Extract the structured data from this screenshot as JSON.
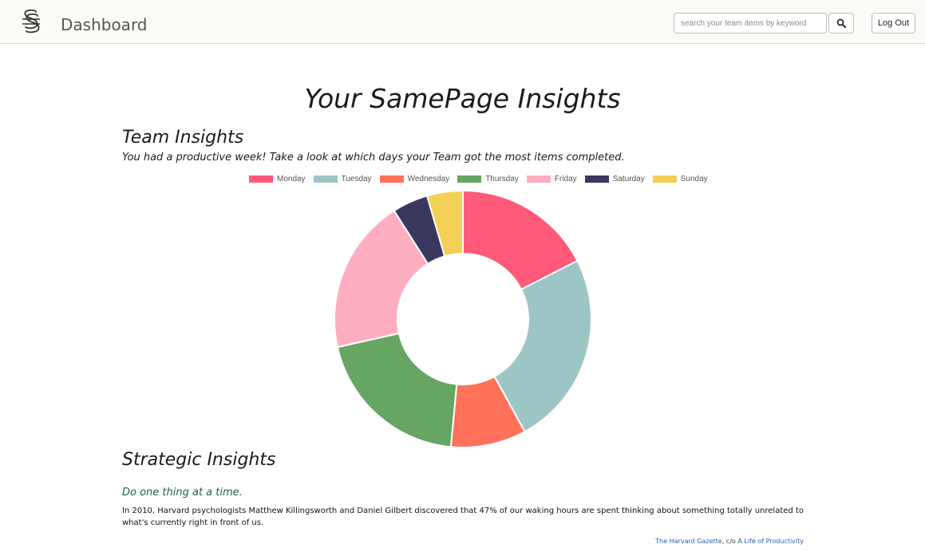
{
  "navbar": {
    "title": "Dashboard",
    "search_placeholder": "search your team items by keyword",
    "search_icon": "search-icon",
    "logout_label": "Log Out",
    "logo_icon": "samepage-logo"
  },
  "page": {
    "title": "Your SamePage Insights"
  },
  "team_insights": {
    "title": "Team Insights",
    "subtitle": "You had a productive week! Take a look at which days your Team got the most items completed."
  },
  "chart_data": {
    "type": "pie",
    "variant": "doughnut",
    "legend_position": "top",
    "categories": [
      "Monday",
      "Tuesday",
      "Wednesday",
      "Thursday",
      "Friday",
      "Saturday",
      "Sunday"
    ],
    "values": [
      17.5,
      24.5,
      9.5,
      20.0,
      19.5,
      4.5,
      4.5
    ],
    "colors": [
      "#ff5a79",
      "#9ec5c5",
      "#ff715a",
      "#66a562",
      "#ffadc0",
      "#3b3860",
      "#f2cf55"
    ]
  },
  "strategic_insights": {
    "title": "Strategic Insights",
    "tip_title": "Do one thing at a time.",
    "tip_body": "In 2010, Harvard psychologists Matthew Killingsworth and Daniel Gilbert discovered that 47% of our waking hours are spent thinking about something totally unrelated to what's currently right in front of us.",
    "source_label": "The Harvard Gazette",
    "source_separator": ", c/o ",
    "via_label": "A Life of Productivity"
  }
}
